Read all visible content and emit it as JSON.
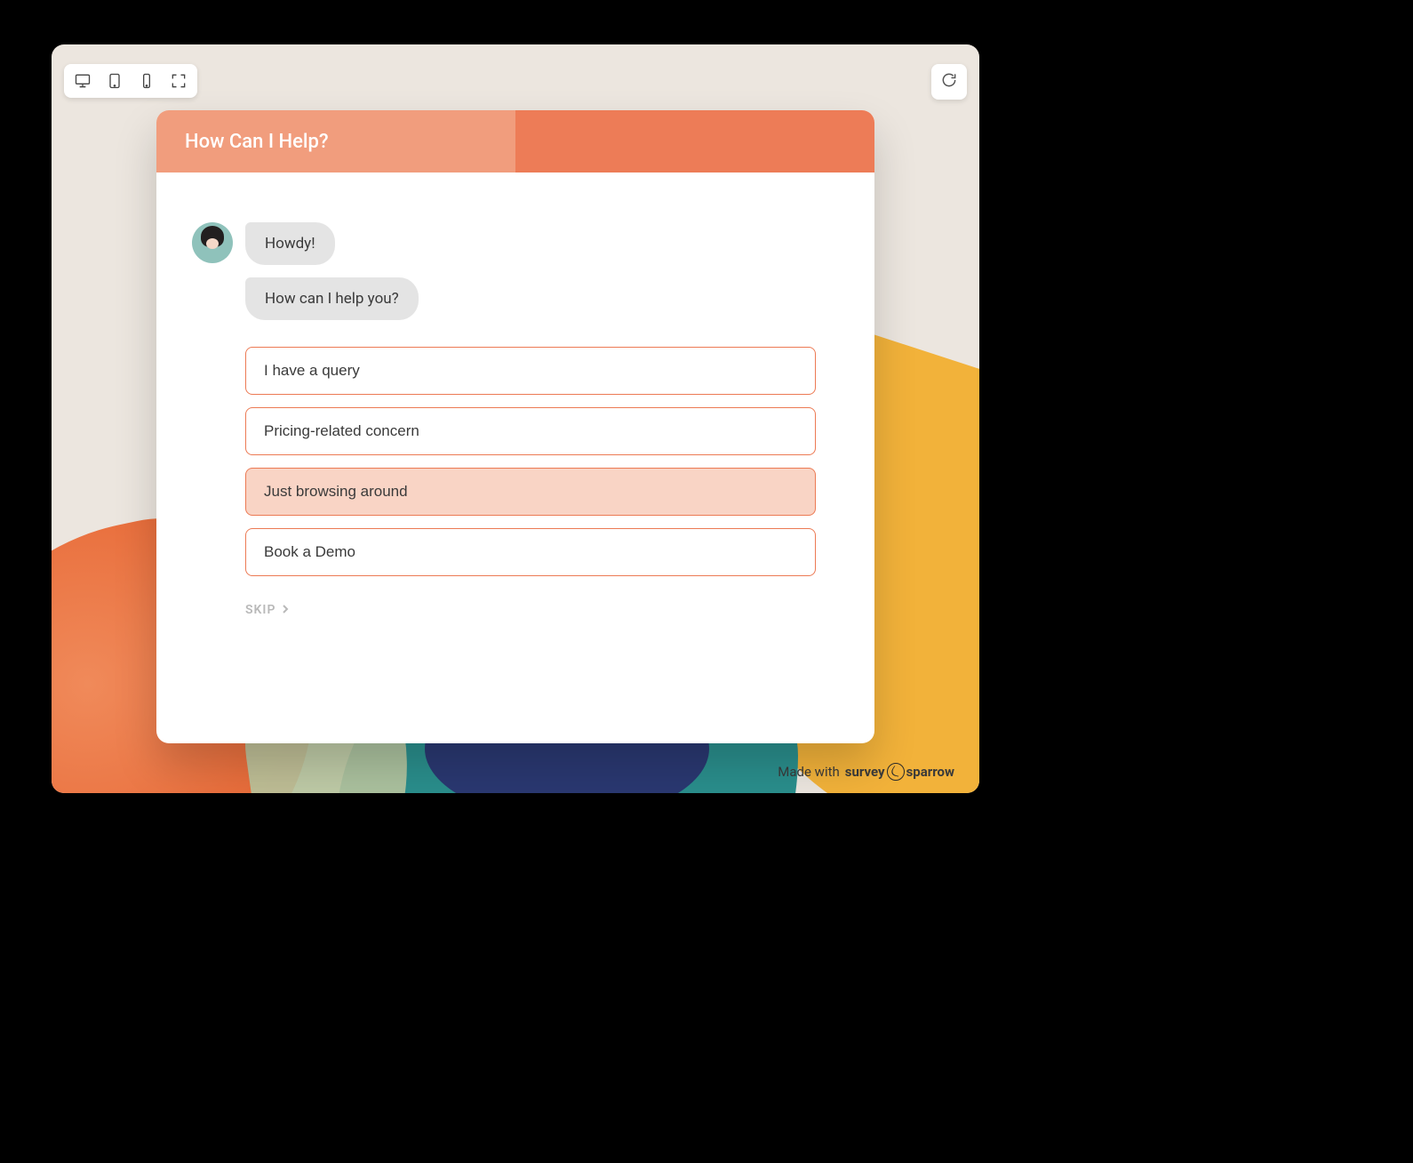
{
  "header": {
    "title": "How Can I Help?"
  },
  "chat": {
    "bubble1": "Howdy!",
    "bubble2": "How can I help you?"
  },
  "options": [
    {
      "label": "I have a query",
      "selected": false
    },
    {
      "label": "Pricing-related concern",
      "selected": false
    },
    {
      "label": "Just browsing around",
      "selected": true
    },
    {
      "label": "Book a Demo",
      "selected": false
    }
  ],
  "skip_label": "SKIP",
  "branding": {
    "prefix": "Made with",
    "brand_a": "survey",
    "brand_b": "sparrow"
  },
  "colors": {
    "accent": "#ed7c57",
    "accent_light": "#f19d7d",
    "option_selected_bg": "#f9d4c5"
  }
}
